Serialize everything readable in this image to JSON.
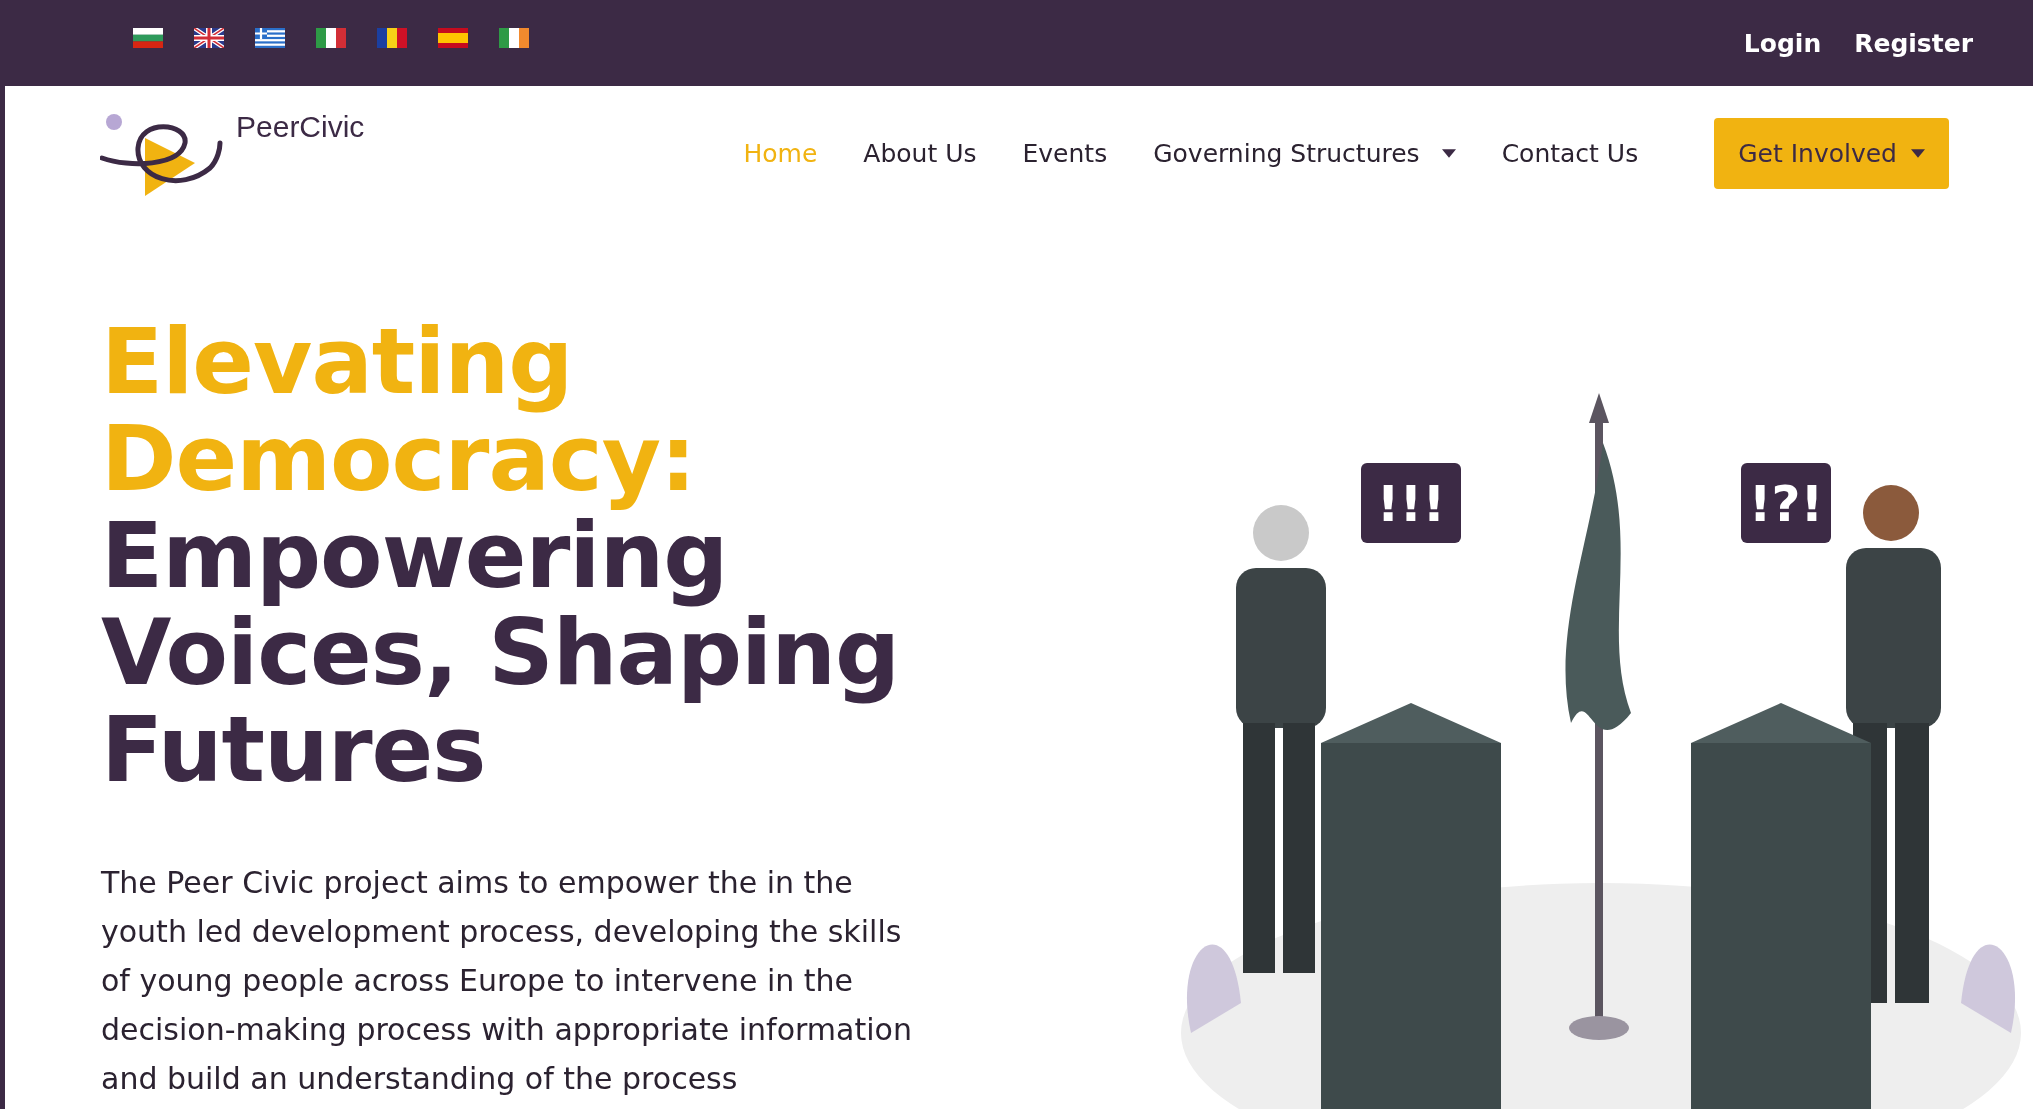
{
  "top_bar": {
    "languages": [
      {
        "kind": "bg"
      },
      {
        "kind": "gb"
      },
      {
        "kind": "gr"
      },
      {
        "kind": "it"
      },
      {
        "kind": "ro"
      },
      {
        "kind": "es"
      },
      {
        "kind": "ie"
      }
    ],
    "links": [
      "Login",
      "Register"
    ]
  },
  "header": {
    "logo_text": "PeerCivic",
    "nav": [
      {
        "label": "Home",
        "selected": true,
        "dropdown": false
      },
      {
        "label": "About Us",
        "selected": false,
        "dropdown": false
      },
      {
        "label": "Events",
        "selected": false,
        "dropdown": false
      },
      {
        "label": "Governing Structures",
        "selected": false,
        "dropdown": true
      },
      {
        "label": "Contact Us",
        "selected": false,
        "dropdown": false
      }
    ],
    "cta": {
      "label": "Get Involved",
      "dropdown": true
    }
  },
  "hero": {
    "title_lines": [
      {
        "text": "Elevating",
        "accent": true
      },
      {
        "text": "Democracy:",
        "accent": true
      },
      {
        "text": "Empowering",
        "accent": false
      },
      {
        "text": "Voices, Shaping",
        "accent": false
      },
      {
        "text": "Futures",
        "accent": false
      }
    ],
    "description": "The Peer Civic project aims to empower the in the youth led development process, developing the skills of young people across Europe to intervene in the decision-making process with appropriate information and build an understanding of the process",
    "illustration": {
      "bubbles": [
        "!!!",
        "!?!"
      ]
    }
  }
}
